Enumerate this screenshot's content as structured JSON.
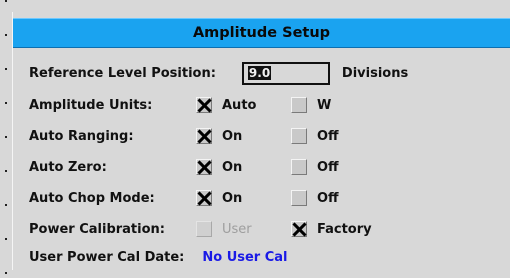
{
  "dialog": {
    "title": "Amplitude Setup"
  },
  "reference_level": {
    "label": "Reference Level Position:",
    "value": "9.0",
    "unit": "Divisions"
  },
  "settings": [
    {
      "label": "Amplitude Units:",
      "opt1": "Auto",
      "opt1_checked": true,
      "opt2": "W",
      "opt2_checked": false
    },
    {
      "label": "Auto Ranging:",
      "opt1": "On",
      "opt1_checked": true,
      "opt2": "Off",
      "opt2_checked": false
    },
    {
      "label": "Auto Zero:",
      "opt1": "On",
      "opt1_checked": true,
      "opt2": "Off",
      "opt2_checked": false
    },
    {
      "label": "Auto Chop Mode:",
      "opt1": "On",
      "opt1_checked": true,
      "opt2": "Off",
      "opt2_checked": false
    },
    {
      "label": "Power Calibration:",
      "opt1": "User",
      "opt1_checked": false,
      "opt1_disabled": true,
      "opt2": "Factory",
      "opt2_checked": true
    }
  ],
  "user_cal": {
    "label": "User Power Cal Date:",
    "value": "No User Cal",
    "value_color": "#1a1ae6"
  },
  "colors": {
    "title_bar": "#1aa3f0",
    "background": "#d8d8d8"
  }
}
